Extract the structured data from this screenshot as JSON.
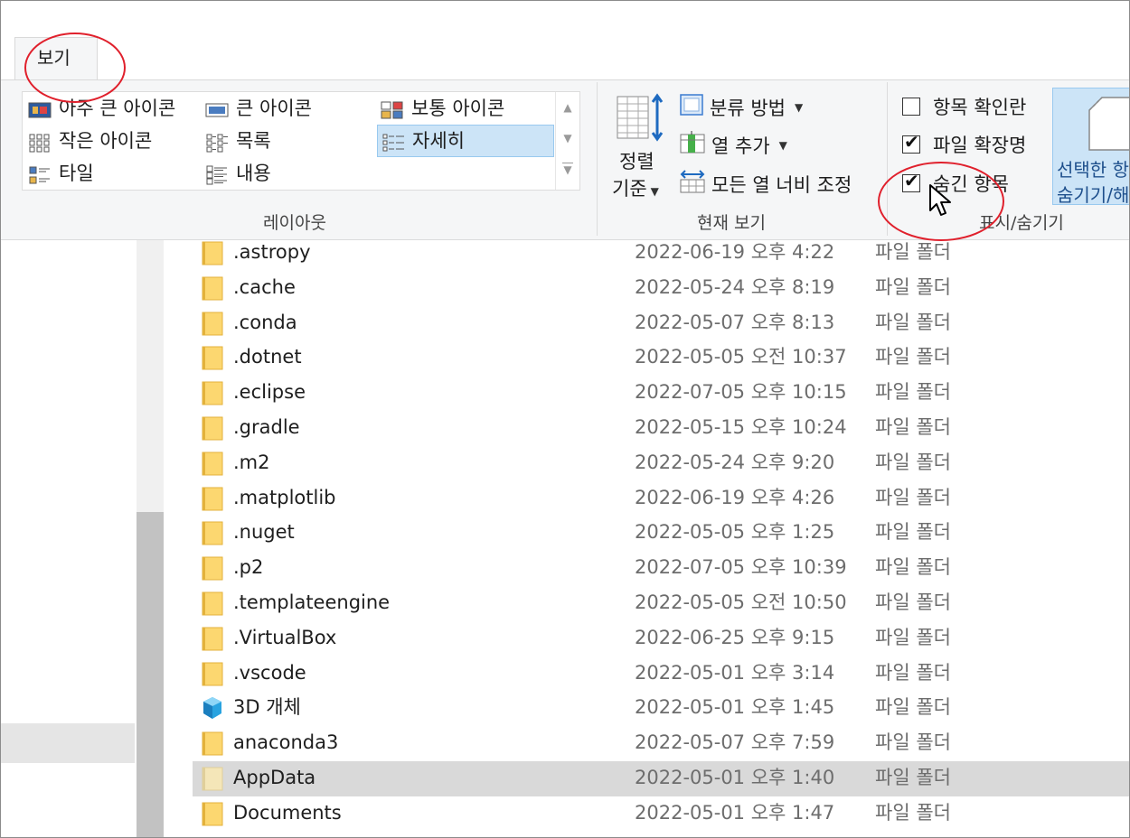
{
  "ribbon": {
    "tab_label": "보기",
    "layout": {
      "group_label": "레이아웃",
      "items": [
        {
          "label": "아주 큰 아이콘",
          "icon": "extra-large-icons-icon"
        },
        {
          "label": "큰 아이콘",
          "icon": "large-icons-icon"
        },
        {
          "label": "보통 아이콘",
          "icon": "medium-icons-icon"
        },
        {
          "label": "작은 아이콘",
          "icon": "small-icons-icon"
        },
        {
          "label": "목록",
          "icon": "list-icon"
        },
        {
          "label": "자세히",
          "icon": "details-icon",
          "selected": true
        },
        {
          "label": "타일",
          "icon": "tiles-icon"
        },
        {
          "label": "내용",
          "icon": "content-icon"
        }
      ]
    },
    "current_view": {
      "group_label": "현재 보기",
      "sort_label_line1": "정렬",
      "sort_label_line2": "기준",
      "group_by": "분류 방법",
      "add_column": "열 추가",
      "size_columns": "모든 열 너비 조정"
    },
    "show_hide": {
      "group_label": "표시/숨기기",
      "item_checkboxes": {
        "label": "항목 확인란",
        "checked": false
      },
      "file_extensions": {
        "label": "파일 확장명",
        "checked": true
      },
      "hidden_items": {
        "label": "숨긴 항목",
        "checked": true
      },
      "hide_selected_line1": "선택한 항",
      "hide_selected_line2": "숨기기/해"
    }
  },
  "files": [
    {
      "name": ".astropy",
      "date": "2022-06-19 오후 4:22",
      "type": "파일 폴더",
      "icon": "folder-icon"
    },
    {
      "name": ".cache",
      "date": "2022-05-24 오후 8:19",
      "type": "파일 폴더",
      "icon": "folder-icon"
    },
    {
      "name": ".conda",
      "date": "2022-05-07 오후 8:13",
      "type": "파일 폴더",
      "icon": "folder-icon"
    },
    {
      "name": ".dotnet",
      "date": "2022-05-05 오전 10:37",
      "type": "파일 폴더",
      "icon": "folder-icon"
    },
    {
      "name": ".eclipse",
      "date": "2022-07-05 오후 10:15",
      "type": "파일 폴더",
      "icon": "folder-icon"
    },
    {
      "name": ".gradle",
      "date": "2022-05-15 오후 10:24",
      "type": "파일 폴더",
      "icon": "folder-icon"
    },
    {
      "name": ".m2",
      "date": "2022-05-24 오후 9:20",
      "type": "파일 폴더",
      "icon": "folder-icon"
    },
    {
      "name": ".matplotlib",
      "date": "2022-06-19 오후 4:26",
      "type": "파일 폴더",
      "icon": "folder-icon"
    },
    {
      "name": ".nuget",
      "date": "2022-05-05 오후 1:25",
      "type": "파일 폴더",
      "icon": "folder-icon"
    },
    {
      "name": ".p2",
      "date": "2022-07-05 오후 10:39",
      "type": "파일 폴더",
      "icon": "folder-icon"
    },
    {
      "name": ".templateengine",
      "date": "2022-05-05 오전 10:50",
      "type": "파일 폴더",
      "icon": "folder-icon"
    },
    {
      "name": ".VirtualBox",
      "date": "2022-06-25 오후 9:15",
      "type": "파일 폴더",
      "icon": "folder-icon"
    },
    {
      "name": ".vscode",
      "date": "2022-05-01 오후 3:14",
      "type": "파일 폴더",
      "icon": "folder-icon"
    },
    {
      "name": "3D 개체",
      "date": "2022-05-01 오후 1:45",
      "type": "파일 폴더",
      "icon": "3d-objects-icon"
    },
    {
      "name": "anaconda3",
      "date": "2022-05-07 오후 7:59",
      "type": "파일 폴더",
      "icon": "folder-icon"
    },
    {
      "name": "AppData",
      "date": "2022-05-01 오후 1:40",
      "type": "파일 폴더",
      "icon": "hidden-folder-icon",
      "highlight": true
    },
    {
      "name": "Documents",
      "date": "2022-05-01 오후 1:47",
      "type": "파일 폴더",
      "icon": "folder-icon"
    }
  ],
  "colors": {
    "ribbon_bg": "#f5f6f7",
    "selection": "#cce4f7",
    "annotation": "#e0202c",
    "folder": "#fcd770"
  }
}
